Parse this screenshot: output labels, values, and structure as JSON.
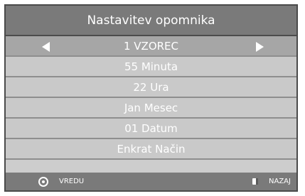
{
  "menu": {
    "title": "Nastavitev opomnika",
    "rows": [
      {
        "label": "1 VZOREC"
      },
      {
        "label": "55 Minuta"
      },
      {
        "label": "22 Ura"
      },
      {
        "label": "Jan Mesec"
      },
      {
        "label": "01 Datum"
      },
      {
        "label": "Enkrat Način"
      }
    ]
  },
  "footer": {
    "ok_label": "VREDU",
    "back_label": "NAZAJ",
    "ok_icon": "ok-circle-icon",
    "back_icon": "back-icon"
  },
  "colors": {
    "title_bar": "#7a7a7a",
    "selected_row": "#a6a6a6",
    "row": "#c9c9c9",
    "text": "#ffffff"
  }
}
